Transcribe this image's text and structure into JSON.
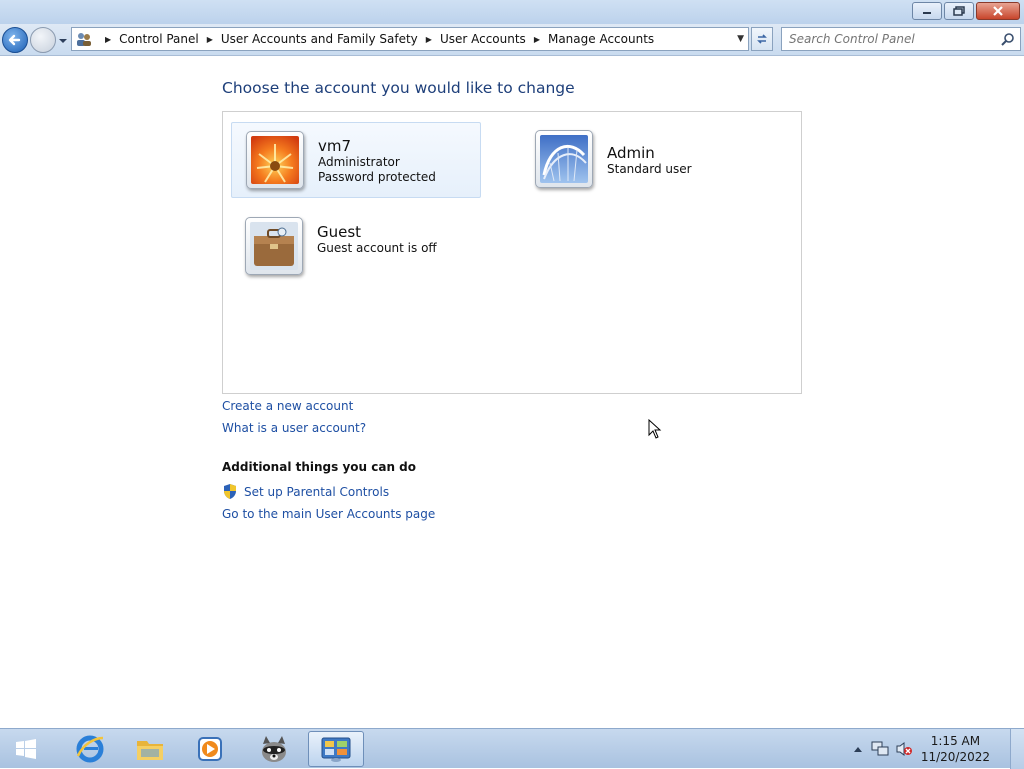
{
  "window": {
    "buttons": {
      "minimize": "minimize",
      "maximize": "restore",
      "close": "close"
    }
  },
  "address_bar": {
    "breadcrumbs": [
      "Control Panel",
      "User Accounts and Family Safety",
      "User Accounts",
      "Manage Accounts"
    ],
    "search_placeholder": "Search Control Panel"
  },
  "main": {
    "heading": "Choose the account you would like to change",
    "accounts": [
      {
        "name": "vm7",
        "lines": [
          "Administrator",
          "Password protected"
        ],
        "selected": true,
        "picture": "flower"
      },
      {
        "name": "Admin",
        "lines": [
          "Standard user"
        ],
        "selected": false,
        "picture": "roller-coaster"
      },
      {
        "name": "Guest",
        "lines": [
          "Guest account is off"
        ],
        "selected": false,
        "picture": "briefcase"
      }
    ],
    "links": {
      "create_account": "Create a new account",
      "what_is_account": "What is a user account?"
    },
    "additional": {
      "heading": "Additional things you can do",
      "parental_controls": "Set up Parental Controls",
      "main_page": "Go to the main User Accounts page"
    }
  },
  "taskbar": {
    "items": [
      "start-button",
      "internet-explorer",
      "file-explorer",
      "media-player",
      "raccoon-app",
      "control-panel"
    ],
    "clock": {
      "time": "1:15 AM",
      "date": "11/20/2022"
    }
  },
  "colors": {
    "link": "#1e4fa3",
    "heading": "#1e3f7a",
    "taskbar": "#b8cde6"
  }
}
